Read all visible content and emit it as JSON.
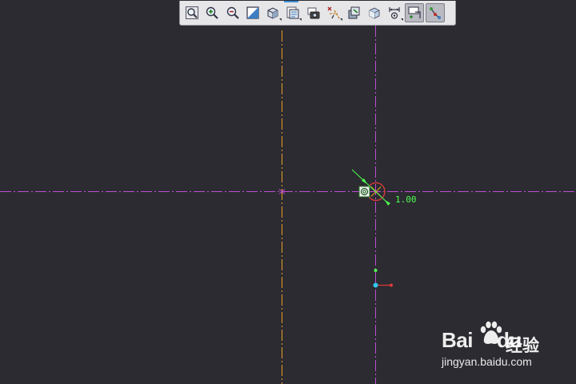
{
  "toolbar": {
    "buttons": [
      {
        "id": "refit",
        "icon": "zoom-fit-icon"
      },
      {
        "id": "zoom-in",
        "icon": "zoom-in-icon"
      },
      {
        "id": "zoom-out",
        "icon": "zoom-out-icon"
      },
      {
        "id": "repaint",
        "icon": "repaint-icon"
      },
      {
        "id": "orientation",
        "icon": "view-cube-icon",
        "has_menu": true
      },
      {
        "id": "saved-views",
        "icon": "saved-views-icon",
        "has_menu": true
      },
      {
        "id": "view-manager",
        "icon": "view-manager-icon"
      },
      {
        "id": "datum-display",
        "icon": "datum-display-icon",
        "has_menu": true
      },
      {
        "id": "spin-center",
        "icon": "spin-center-icon"
      },
      {
        "id": "display-style",
        "icon": "display-style-icon",
        "has_menu": true
      },
      {
        "id": "dimension-display",
        "icon": "dimension-display-icon",
        "has_menu": true
      },
      {
        "id": "constraint-display",
        "icon": "constraint-display-icon",
        "pressed": true
      },
      {
        "id": "vertex-display",
        "icon": "vertex-display-icon",
        "pressed": true
      }
    ]
  },
  "sketch": {
    "dimension_value": "1.00",
    "colors": {
      "background": "#2c2b31",
      "horizontal_centerline": "#c04bd8",
      "vertical_centerline_left": "#e6a020",
      "vertical_centerline_right": "#c04bd8",
      "circle": "#e23a3a",
      "dimension": "#4dff4d",
      "csys_origin": "#2fc9f0",
      "csys_x_axis": "#e23a3a"
    }
  },
  "watermark": {
    "logo_text": "Bai",
    "logo_suffix": "du",
    "product_text": "经验",
    "url": "jingyan.baidu.com"
  }
}
